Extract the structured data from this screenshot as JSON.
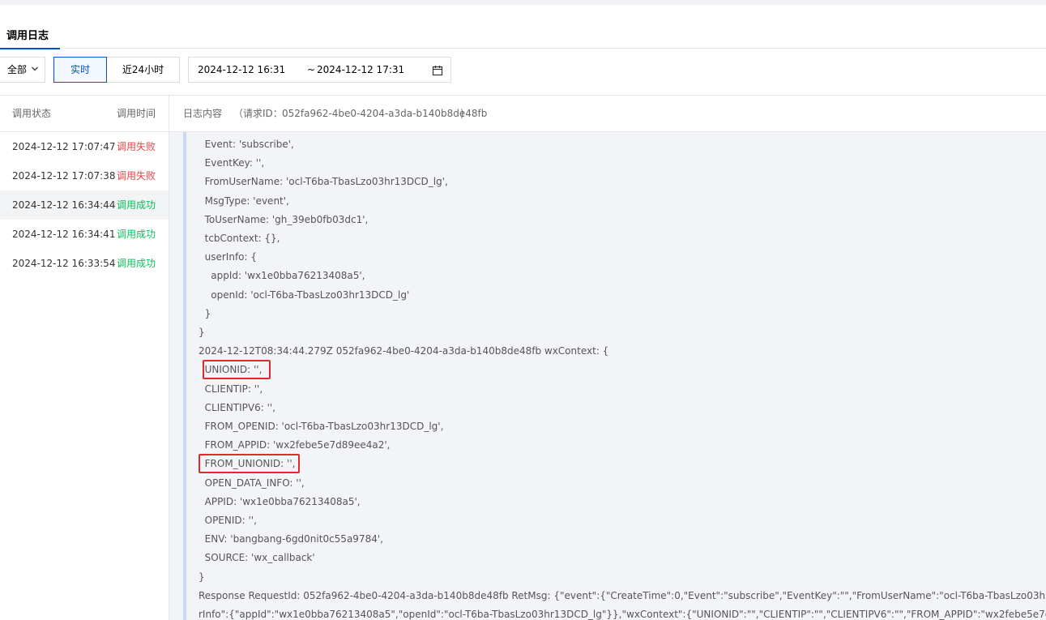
{
  "tabs": [
    {
      "label": "调用日志",
      "active": true
    }
  ],
  "filters": {
    "select_all": "全部",
    "btn_realtime": "实时",
    "btn_24h": "近24小时",
    "date_start": "2024-12-12 16:31",
    "date_sep": "~",
    "date_end": "2024-12-12 17:31"
  },
  "table": {
    "headers": {
      "status": "调用状态",
      "time": "调用时间",
      "log_content": "日志内容",
      "request_id_prefix": "（请求ID：",
      "request_id": "052fa962-4be0-4204-a3da-b140b8de48fb",
      "request_id_suffix": ")"
    },
    "rows": [
      {
        "time": "2024-12-12 17:07:47",
        "status": "调用失败",
        "ok": false
      },
      {
        "time": "2024-12-12 17:07:38",
        "status": "调用失败",
        "ok": false
      },
      {
        "time": "2024-12-12 16:34:44",
        "status": "调用成功",
        "ok": true,
        "selected": true
      },
      {
        "time": "2024-12-12 16:34:41",
        "status": "调用成功",
        "ok": true
      },
      {
        "time": "2024-12-12 16:33:54",
        "status": "调用成功",
        "ok": true
      }
    ]
  },
  "log": {
    "lines": [
      {
        "text": "  Event: 'subscribe',"
      },
      {
        "text": "  EventKey: '',"
      },
      {
        "text": "  FromUserName: 'ocl-T6ba-TbasLzo03hr13DCD_lg',"
      },
      {
        "text": "  MsgType: 'event',"
      },
      {
        "text": "  ToUserName: 'gh_39eb0fb03dc1',"
      },
      {
        "text": "  tcbContext: {},"
      },
      {
        "text": "  userInfo: {"
      },
      {
        "text": "    appId: 'wx1e0bba76213408a5',"
      },
      {
        "text": "    openId: 'ocl-T6ba-TbasLzo03hr13DCD_lg'"
      },
      {
        "text": "  }"
      },
      {
        "text": "}"
      },
      {
        "text": "2024-12-12T08:34:44.279Z 052fa962-4be0-4204-a3da-b140b8de48fb wxContext: {"
      },
      {
        "text": "  UNIONID: '',",
        "highlight": true
      },
      {
        "text": "  CLIENTIP: '',"
      },
      {
        "text": "  CLIENTIPV6: '',"
      },
      {
        "text": "  FROM_OPENID: 'ocl-T6ba-TbasLzo03hr13DCD_lg',"
      },
      {
        "text": "  FROM_APPID: 'wx2febe5e7d89ee4a2',"
      },
      {
        "text": "  FROM_UNIONID: '',",
        "highlight": true
      },
      {
        "text": "  OPEN_DATA_INFO: '',"
      },
      {
        "text": "  APPID: 'wx1e0bba76213408a5',"
      },
      {
        "text": "  OPENID: '',"
      },
      {
        "text": "  ENV: 'bangbang-6gd0nit0c55a9784',"
      },
      {
        "text": "  SOURCE: 'wx_callback'"
      },
      {
        "text": "}"
      },
      {
        "text": "Response RequestId: 052fa962-4be0-4204-a3da-b140b8de48fb RetMsg: {\"event\":{\"CreateTime\":0,\"Event\":\"subscribe\",\"EventKey\":\"\",\"FromUserName\":\"ocl-T6ba-TbasLzo03hr13DCD_lg\",\"MsgType\":\"event\",\"ToUserName\":\"gh_39eb0fb03dc1\",\"tcbContext\":{},\"use"
      },
      {
        "text": "rInfo\":{\"appId\":\"wx1e0bba76213408a5\",\"openId\":\"ocl-T6ba-TbasLzo03hr13DCD_lg\"}},\"wxContext\":{\"UNIONID\":\"\",\"CLIENTIP\":\"\",\"CLIENTIPV6\":\"\",\"FROM_APPID\":\"wx2febe5e7d89ee4a2\",\"FROM_OPENID\":\"ocl-T6ba-TbasLzo03hr13DCD_lg\"}}"
      }
    ]
  },
  "colors": {
    "accent": "#0052d9",
    "fail": "#e54545",
    "success": "#0abf5b",
    "highlight_box": "#e02b2b"
  }
}
